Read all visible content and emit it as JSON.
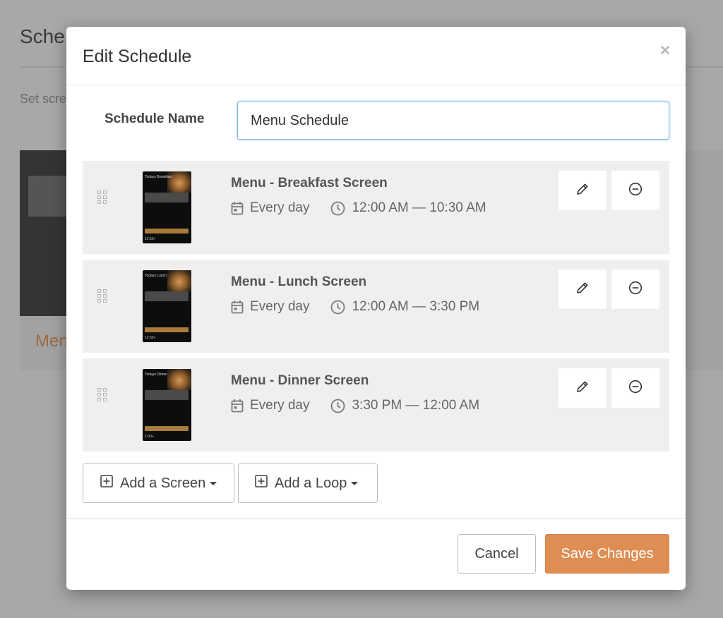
{
  "background": {
    "title": "Sche",
    "subtitle": "Set scre",
    "card_label": "Men"
  },
  "modal": {
    "title": "Edit Schedule",
    "close_glyph": "×",
    "schedule_name_label": "Schedule Name",
    "schedule_name_value": "Menu Schedule"
  },
  "items": [
    {
      "title": "Menu - Breakfast Screen",
      "days": "Every day",
      "time": "12:00 AM — 10:30 AM",
      "thumb_title": "Todays Breakfast",
      "thumb_foot": "12:52+"
    },
    {
      "title": "Menu - Lunch Screen",
      "days": "Every day",
      "time": "12:00 AM — 3:30 PM",
      "thumb_title": "Todays Lunch",
      "thumb_foot": "12:52+"
    },
    {
      "title": "Menu - Dinner Screen",
      "days": "Every day",
      "time": "3:30 PM — 12:00 AM",
      "thumb_title": "Todays Dinner",
      "thumb_foot": "1:00+"
    }
  ],
  "actions": {
    "add_screen": "Add a Screen",
    "add_loop": "Add a Loop",
    "cancel": "Cancel",
    "save": "Save Changes"
  },
  "icons": {
    "drag": "drag-handle-icon",
    "calendar": "calendar-icon",
    "clock": "clock-icon",
    "edit": "pencil-icon",
    "remove": "minus-circle-icon",
    "add": "plus-square-icon",
    "close": "close-icon"
  },
  "colors": {
    "primary_button": "#de8d53",
    "input_focus_border": "#7fb4ea",
    "row_background": "#efefef",
    "overlay": "#a8a8a8"
  }
}
